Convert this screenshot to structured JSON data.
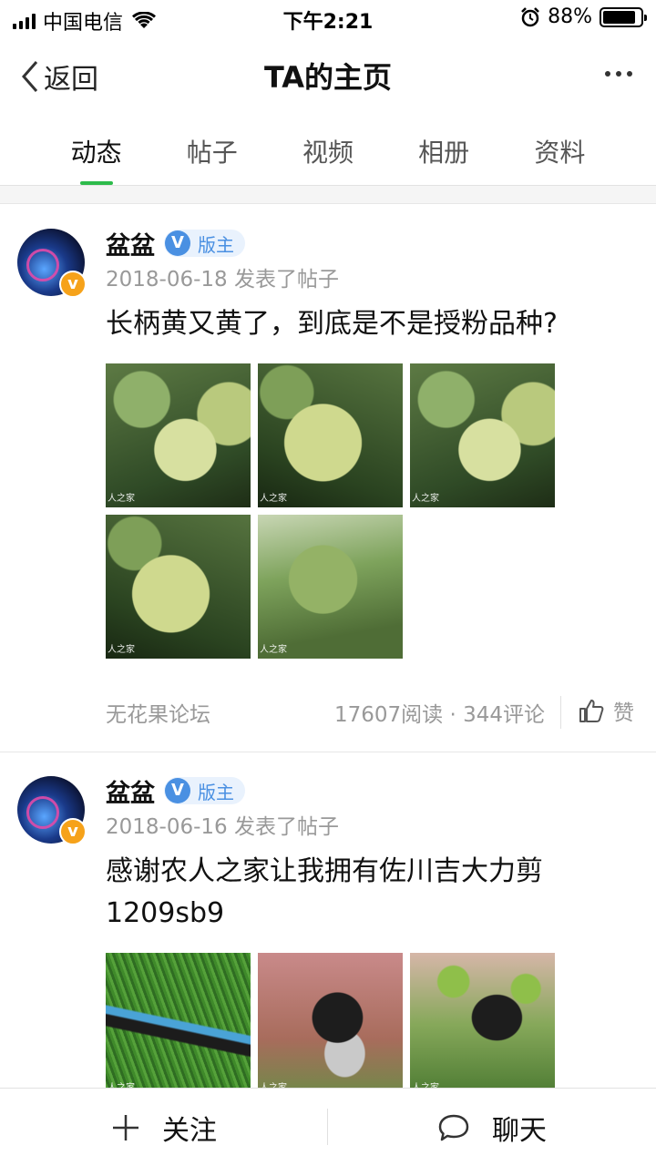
{
  "status_bar": {
    "carrier": "中国电信",
    "time": "下午2:21",
    "battery_percent": "88%",
    "battery_level": 0.88
  },
  "nav": {
    "back_label": "返回",
    "title": "TA的主页"
  },
  "tabs": [
    {
      "label": "动态",
      "active": true
    },
    {
      "label": "帖子",
      "active": false
    },
    {
      "label": "视频",
      "active": false
    },
    {
      "label": "相册",
      "active": false
    },
    {
      "label": "资料",
      "active": false
    }
  ],
  "posts": [
    {
      "user": "盆盆",
      "role_badge": "版主",
      "meta": "2018-06-18 发表了帖子",
      "text": "长柄黄又黄了，到底是不是授粉品种?",
      "watermark": "人之家",
      "forum": "无花果论坛",
      "stats": "17607阅读 · 344评论",
      "like_label": "赞"
    },
    {
      "user": "盆盆",
      "role_badge": "版主",
      "meta": "2018-06-16 发表了帖子",
      "text": "感谢农人之家让我拥有佐川吉大力剪1209sb9",
      "watermark": "人之家"
    }
  ],
  "bottom_bar": {
    "follow_label": "关注",
    "chat_label": "聊天"
  },
  "colors": {
    "accent": "#2dbb4b",
    "badge_blue": "#4a90e2",
    "avatar_badge": "#f6a21a"
  }
}
